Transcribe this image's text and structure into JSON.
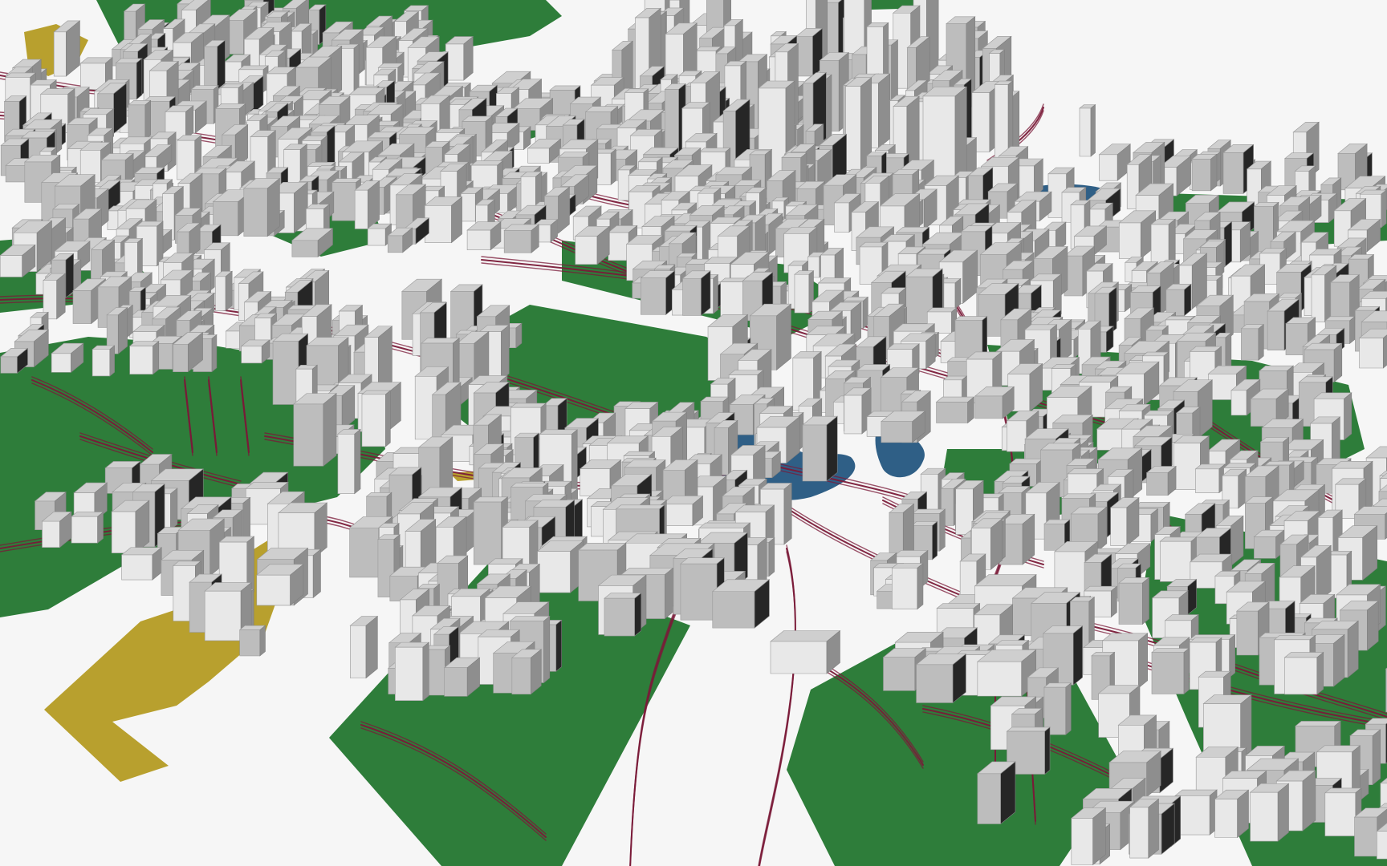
{
  "scene": {
    "description_free": true,
    "view": "oblique-3d-city-model",
    "colors": {
      "background": "#f6f6f6",
      "greenspace": "#2e7d3a",
      "greenspace_dark": "#236b2f",
      "water": "#2f5f86",
      "sand_land": "#b8a02e",
      "road_line": "#7a1a38",
      "building_top": "#cfcfcf",
      "building_light": "#e8e8e8",
      "building_mid": "#bdbdbd",
      "building_shadow": "#8e8e8e",
      "building_dark": "#262626"
    },
    "layers": [
      "greenspace-layer",
      "water-layer",
      "sand-land-layer",
      "road-network-layer",
      "building-layer"
    ]
  }
}
